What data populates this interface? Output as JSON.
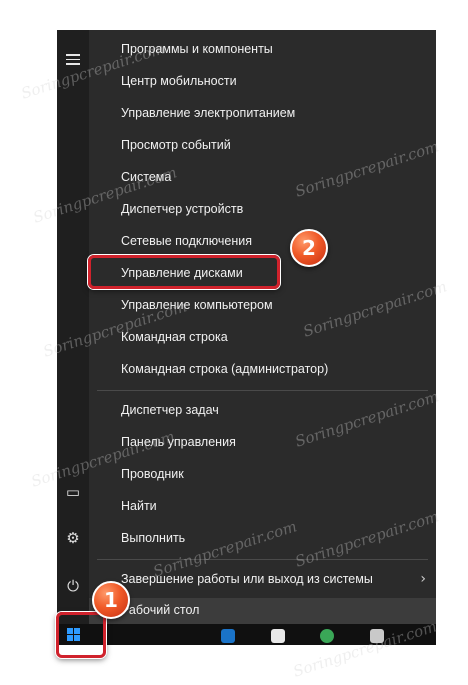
{
  "menu": {
    "group1": [
      "Программы и компоненты",
      "Центр мобильности",
      "Управление электропитанием",
      "Просмотр событий",
      "Система",
      "Диспетчер устройств",
      "Сетевые подключения",
      "Управление дисками",
      "Управление компьютером",
      "Командная строка",
      "Командная строка (администратор)"
    ],
    "group2": [
      "Диспетчер задач",
      "Панель управления",
      "Проводник",
      "Найти",
      "Выполнить"
    ],
    "shutdown": "Завершение работы или выход из системы",
    "desktop": "Рабочий стол"
  },
  "badges": {
    "step1": "1",
    "step2": "2"
  },
  "watermark": "Soringpcrepair.com",
  "icons": {
    "hamburger": "hamburger-icon",
    "explorer": "file-explorer-icon",
    "settings": "gear-icon",
    "power": "power-icon",
    "start": "windows-logo-icon",
    "chevron": "chevron-right-icon"
  },
  "colors": {
    "menu_bg": "#2b2b2b",
    "highlight": "#d0222c",
    "badge": "#f05a28",
    "win_blue": "#2e9bff"
  }
}
